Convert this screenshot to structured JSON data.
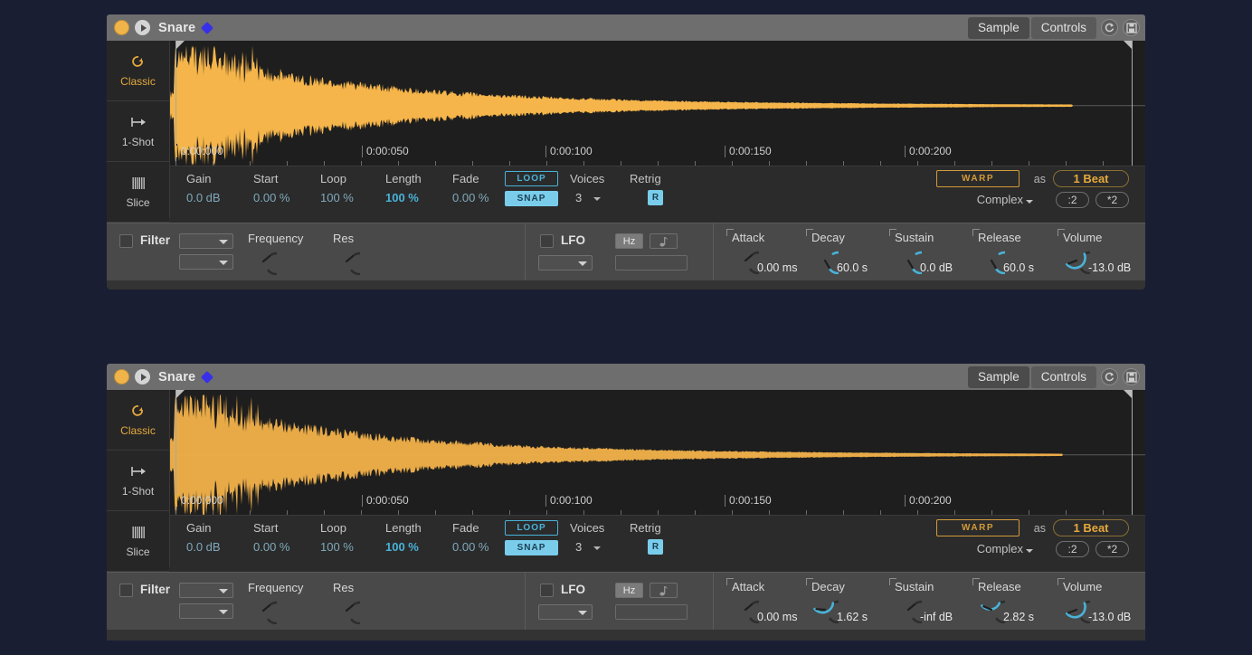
{
  "background_color": "#1a1e33",
  "devices": [
    {
      "id": "device-1",
      "titlebar": {
        "title": "Snare",
        "tabs": [
          {
            "label": "Sample",
            "active": true
          },
          {
            "label": "Controls",
            "active": false
          }
        ],
        "icons": [
          "refresh-icon",
          "save-icon"
        ]
      },
      "sidebar": [
        {
          "label": "Classic",
          "icon": "loop-icon",
          "selected": true
        },
        {
          "label": "1-Shot",
          "icon": "arrow-to-right-icon",
          "selected": false
        },
        {
          "label": "Slice",
          "icon": "slice-bars-icon",
          "selected": false
        }
      ],
      "ruler": [
        "0:00:000",
        "0:00:050",
        "0:00:100",
        "0:00:150",
        "0:00:200"
      ],
      "params": [
        {
          "label": "Gain",
          "value": "0.0 dB",
          "bold": false
        },
        {
          "label": "Start",
          "value": "0.00 %",
          "bold": false
        },
        {
          "label": "Loop",
          "value": "100 %",
          "bold": false
        },
        {
          "label": "Length",
          "value": "100 %",
          "bold": true
        },
        {
          "label": "Fade",
          "value": "0.00 %",
          "bold": false
        }
      ],
      "loop_button": "LOOP",
      "snap_button": "SNAP",
      "voices_label": "Voices",
      "voices_value": "3",
      "retrig_label": "Retrig",
      "retrig_value": "R",
      "warp_button": "WARP",
      "as_label": "as",
      "beat_value": "1 Beat",
      "warp_mode": "Complex",
      "halve_button": ":2",
      "double_button": "*2",
      "filter": {
        "label": "Filter",
        "enabled": false,
        "knobs": [
          {
            "label": "Frequency",
            "value": ""
          },
          {
            "label": "Res",
            "value": ""
          }
        ]
      },
      "lfo": {
        "label": "LFO",
        "enabled": false,
        "hz_button": "Hz",
        "note_button": "note-icon"
      },
      "envelope": [
        {
          "label": "Attack",
          "value": "0.00 ms",
          "arc": 0.0
        },
        {
          "label": "Decay",
          "value": "60.0 s",
          "arc": 1.0
        },
        {
          "label": "Sustain",
          "value": "0.0 dB",
          "arc": 1.0
        },
        {
          "label": "Release",
          "value": "60.0 s",
          "arc": 1.0
        },
        {
          "label": "Volume",
          "value": "-13.0 dB",
          "arc": 0.62
        }
      ]
    },
    {
      "id": "device-2",
      "titlebar": {
        "title": "Snare",
        "tabs": [
          {
            "label": "Sample",
            "active": true
          },
          {
            "label": "Controls",
            "active": false
          }
        ],
        "icons": [
          "refresh-icon",
          "save-icon"
        ]
      },
      "sidebar": [
        {
          "label": "Classic",
          "icon": "loop-icon",
          "selected": true
        },
        {
          "label": "1-Shot",
          "icon": "arrow-to-right-icon",
          "selected": false
        },
        {
          "label": "Slice",
          "icon": "slice-bars-icon",
          "selected": false
        }
      ],
      "ruler": [
        "0:00:000",
        "0:00:050",
        "0:00:100",
        "0:00:150",
        "0:00:200"
      ],
      "params": [
        {
          "label": "Gain",
          "value": "0.0 dB",
          "bold": false
        },
        {
          "label": "Start",
          "value": "0.00 %",
          "bold": false
        },
        {
          "label": "Loop",
          "value": "100 %",
          "bold": false
        },
        {
          "label": "Length",
          "value": "100 %",
          "bold": true
        },
        {
          "label": "Fade",
          "value": "0.00 %",
          "bold": false
        }
      ],
      "loop_button": "LOOP",
      "snap_button": "SNAP",
      "voices_label": "Voices",
      "voices_value": "3",
      "retrig_label": "Retrig",
      "retrig_value": "R",
      "warp_button": "WARP",
      "as_label": "as",
      "beat_value": "1 Beat",
      "warp_mode": "Complex",
      "halve_button": ":2",
      "double_button": "*2",
      "filter": {
        "label": "Filter",
        "enabled": false,
        "knobs": [
          {
            "label": "Frequency",
            "value": ""
          },
          {
            "label": "Res",
            "value": ""
          }
        ]
      },
      "lfo": {
        "label": "LFO",
        "enabled": false,
        "hz_button": "Hz",
        "note_button": "note-icon"
      },
      "envelope": [
        {
          "label": "Attack",
          "value": "0.00 ms",
          "arc": 0.0
        },
        {
          "label": "Decay",
          "value": "1.62 s",
          "arc": 0.52
        },
        {
          "label": "Sustain",
          "value": "-inf dB",
          "arc": 0.0
        },
        {
          "label": "Release",
          "value": "2.82 s",
          "arc": 0.45
        },
        {
          "label": "Volume",
          "value": "-13.0 dB",
          "arc": 0.62
        }
      ]
    }
  ],
  "colors": {
    "waveform": "#f5b54a",
    "accent_cyan": "#49b3d8",
    "accent_orange": "#e5a93c",
    "panel": "#2b2b2b"
  }
}
